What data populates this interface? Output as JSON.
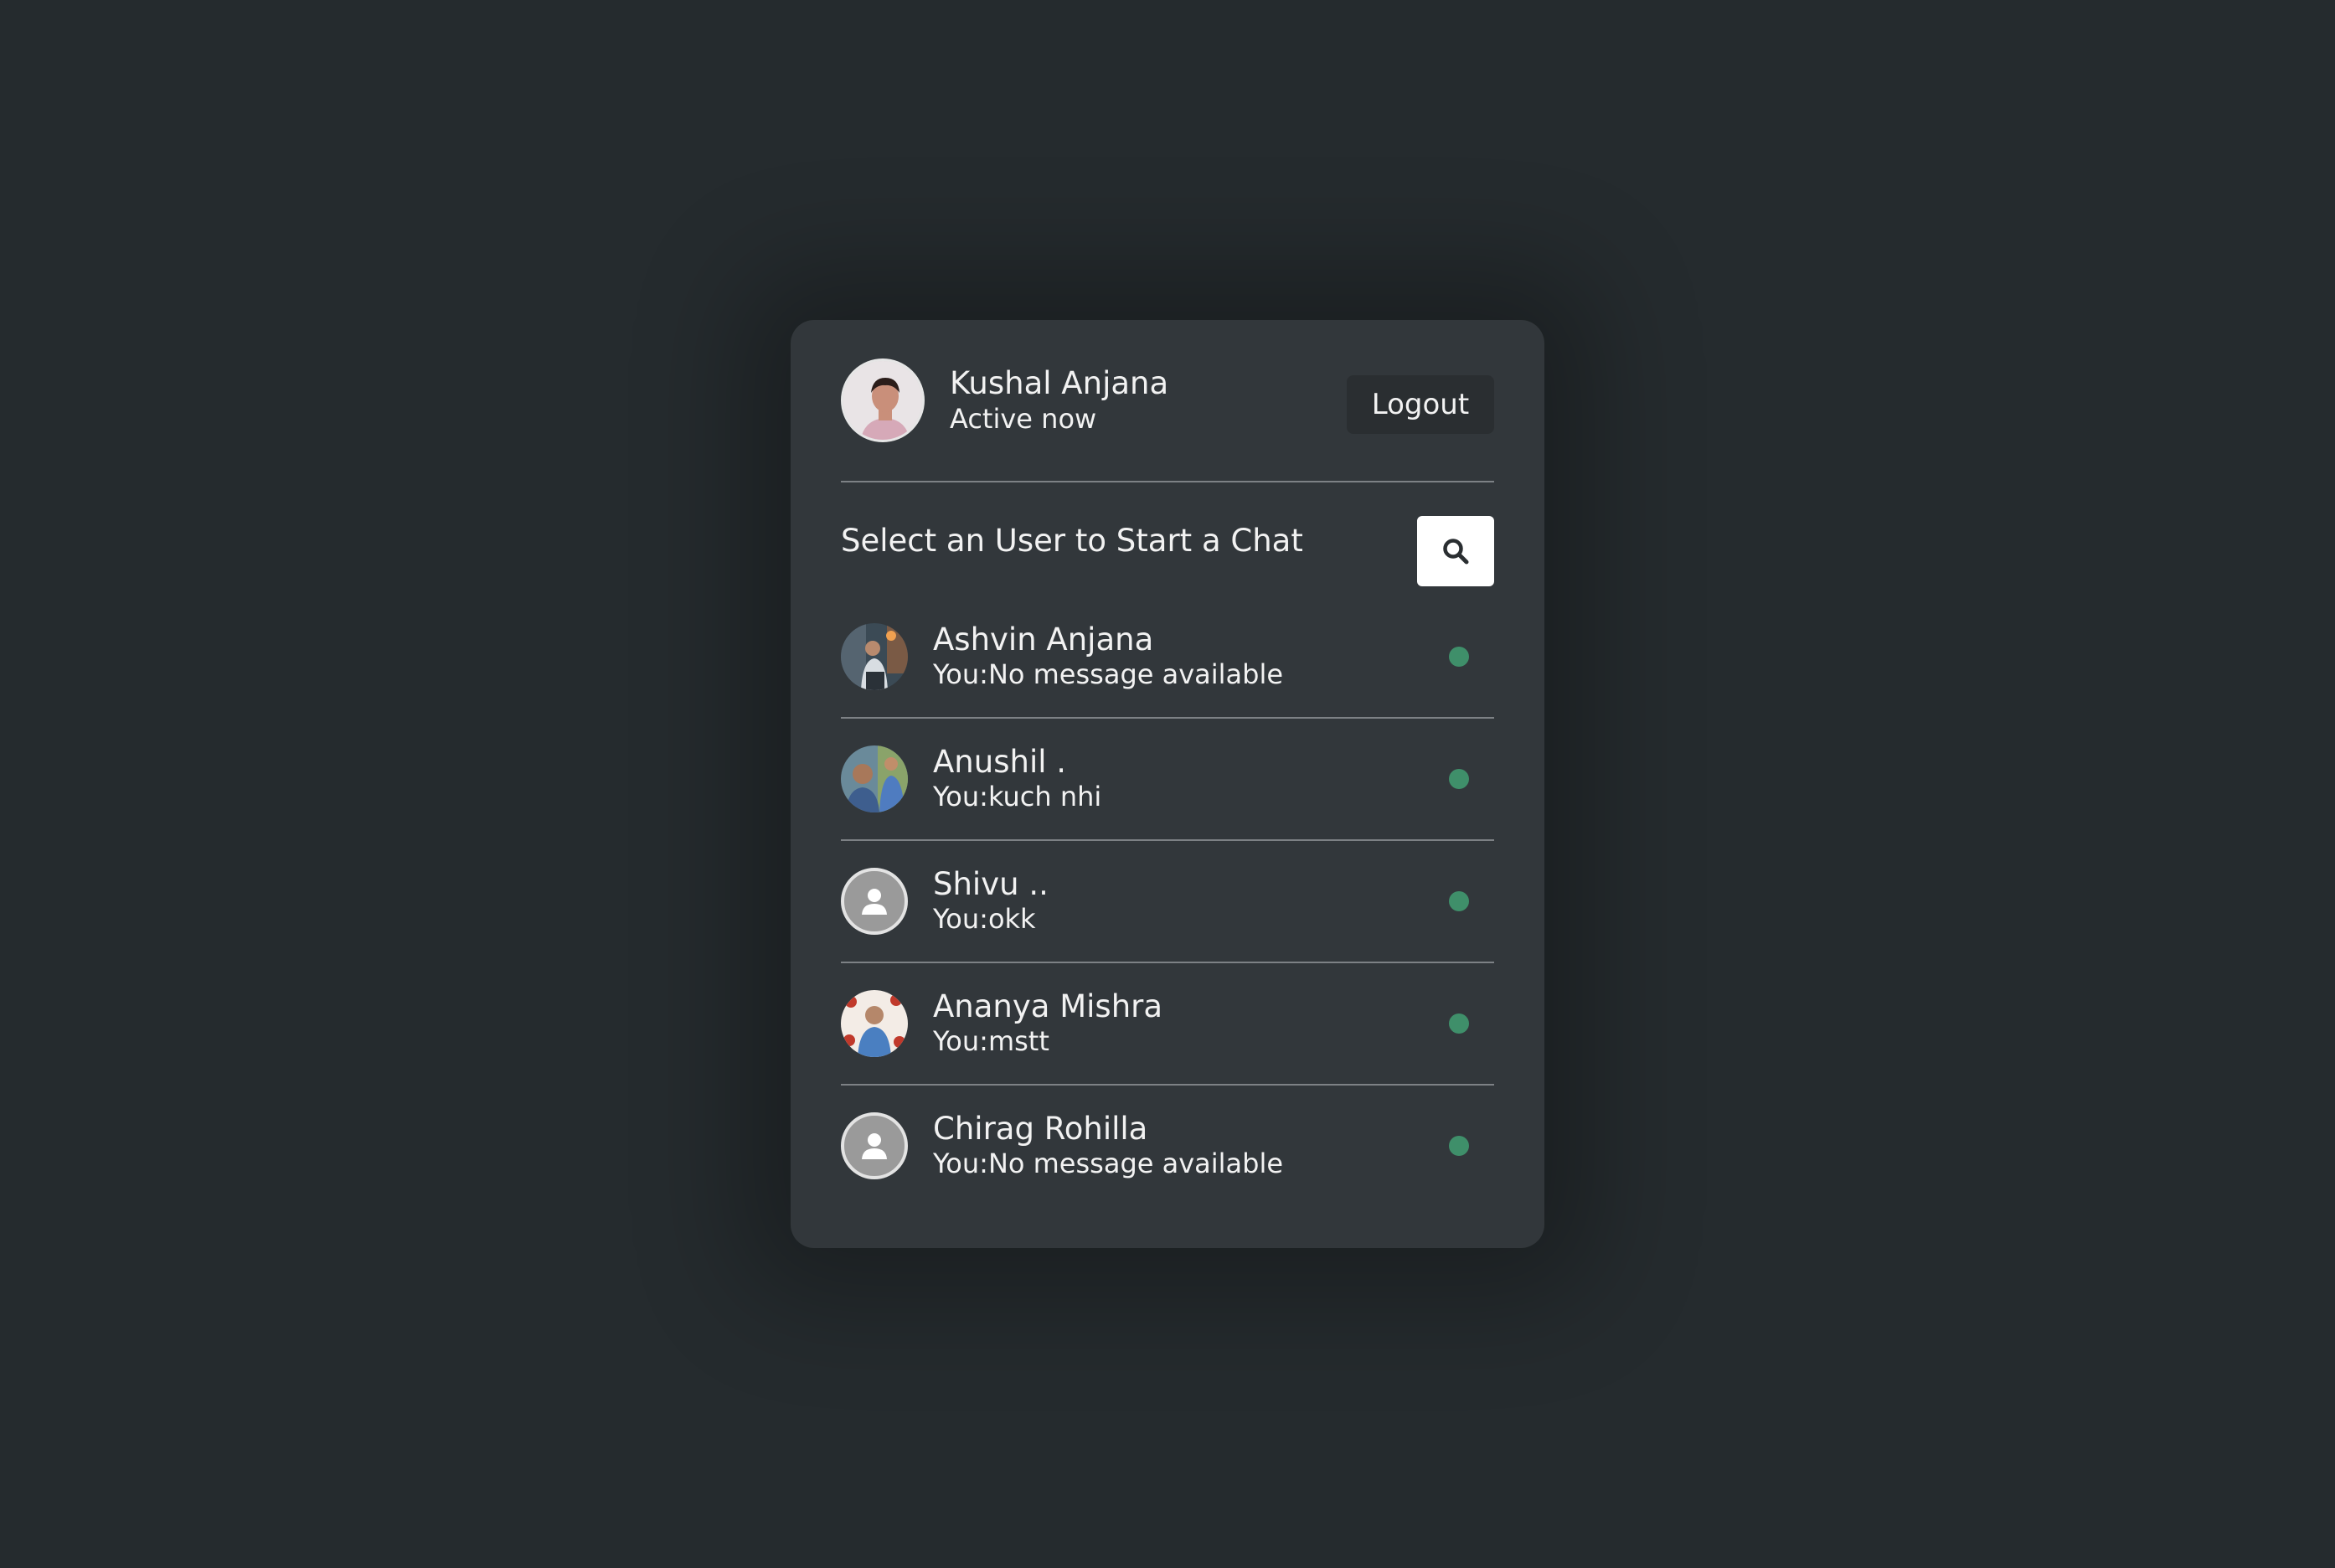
{
  "current_user": {
    "name": "Kushal Anjana",
    "status": "Active now"
  },
  "header": {
    "logout_label": "Logout"
  },
  "search": {
    "prompt": "Select an User to Start a Chat",
    "icon": "search-icon"
  },
  "users": [
    {
      "name": "Ashvin Anjana",
      "message": "You:No message available",
      "avatar": "photo",
      "online": true
    },
    {
      "name": "Anushil .",
      "message": "You:kuch nhi",
      "avatar": "photo",
      "online": true
    },
    {
      "name": "Shivu ..",
      "message": "You:okk",
      "avatar": "default-user-icon",
      "online": true
    },
    {
      "name": "Ananya Mishra",
      "message": "You:mstt",
      "avatar": "photo",
      "online": true
    },
    {
      "name": "Chirag Rohilla",
      "message": "You:No message available",
      "avatar": "default-user-icon",
      "online": true
    }
  ],
  "colors": {
    "background": "#252b2e",
    "card": "#32373b",
    "online_dot": "#3f8f6a",
    "divider": "#7d8185"
  }
}
